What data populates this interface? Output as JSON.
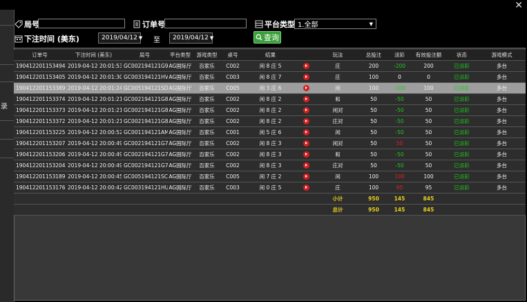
{
  "side_fragment": "录",
  "filters": {
    "round_label": "局号",
    "round_value": "",
    "order_label": "订单号",
    "order_value": "",
    "platform_label": "平台类型",
    "platform_value": "1.全部",
    "time_label": "下注时间 (美东)",
    "date_from": "2019/04/12",
    "to_label": "至",
    "date_to": "2019/04/12",
    "query_label": "查询"
  },
  "table": {
    "headers": [
      "订单号",
      "下注时间 (美东)",
      "局号",
      "平台类型",
      "游戏类型",
      "桌号",
      "结果",
      "",
      "玩法",
      "总投注",
      "派彩",
      "有效投注额",
      "状态",
      "游戏模式"
    ],
    "rows": [
      [
        "190412201153494",
        "2019-04-12 20:01:53",
        "GC002194121G9",
        "AG国际厅",
        "百家乐",
        "C002",
        "闲 8 庄 5",
        "",
        "庄",
        "200",
        "-200",
        "200",
        "已派彩",
        "多台"
      ],
      [
        "190412201153405",
        "2019-04-12 20:01:30",
        "GC003194121HV",
        "AG国际厅",
        "百家乐",
        "C003",
        "闲 8 庄 7",
        "",
        "庄",
        "100",
        "0",
        "0",
        "已派彩",
        "多台"
      ],
      [
        "190412201153389",
        "2019-04-12 20:01:24",
        "GC005194121SD",
        "AG国际厅",
        "百家乐",
        "C005",
        "闲 3 庄 6",
        "",
        "闲",
        "100",
        "-100",
        "100",
        "已派彩",
        "多台"
      ],
      [
        "190412201153374",
        "2019-04-12 20:01:21",
        "GC002194121G8",
        "AG国际厅",
        "百家乐",
        "C002",
        "闲 8 庄 2",
        "",
        "和",
        "50",
        "-50",
        "50",
        "已派彩",
        "多台"
      ],
      [
        "190412201153373",
        "2019-04-12 20:01:21",
        "GC002194121G8",
        "AG国际厅",
        "百家乐",
        "C002",
        "闲 8 庄 2",
        "",
        "闲对",
        "50",
        "-50",
        "50",
        "已派彩",
        "多台"
      ],
      [
        "190412201153372",
        "2019-04-12 20:01:21",
        "GC002194121G8",
        "AG国际厅",
        "百家乐",
        "C002",
        "闲 8 庄 2",
        "",
        "庄对",
        "50",
        "-50",
        "50",
        "已派彩",
        "多台"
      ],
      [
        "190412201153225",
        "2019-04-12 20:00:52",
        "GC001194121AM",
        "AG国际厅",
        "百家乐",
        "C001",
        "闲 5 庄 6",
        "",
        "闲",
        "50",
        "-50",
        "50",
        "已派彩",
        "多台"
      ],
      [
        "190412201153207",
        "2019-04-12 20:00:49",
        "GC002194121G7",
        "AG国际厅",
        "百家乐",
        "C002",
        "闲 8 庄 3",
        "",
        "闲对",
        "50",
        "50",
        "50",
        "已派彩",
        "多台"
      ],
      [
        "190412201153206",
        "2019-04-12 20:00:49",
        "GC002194121G7",
        "AG国际厅",
        "百家乐",
        "C002",
        "闲 8 庄 3",
        "",
        "和",
        "50",
        "-50",
        "50",
        "已派彩",
        "多台"
      ],
      [
        "190412201153204",
        "2019-04-12 20:00:49",
        "GC002194121G7",
        "AG国际厅",
        "百家乐",
        "C002",
        "闲 8 庄 3",
        "",
        "庄对",
        "50",
        "-50",
        "50",
        "已派彩",
        "多台"
      ],
      [
        "190412201153189",
        "2019-04-12 20:00:45",
        "GC005194121SC",
        "AG国际厅",
        "百家乐",
        "C005",
        "闲 7 庄 2",
        "",
        "闲",
        "100",
        "100",
        "100",
        "已派彩",
        "多台"
      ],
      [
        "190412201153176",
        "2019-04-12 20:00:42",
        "GC003194121HU",
        "AG国际厅",
        "百家乐",
        "C003",
        "闲 0 庄 5",
        "",
        "庄",
        "100",
        "95",
        "95",
        "已派彩",
        "多台"
      ]
    ],
    "subtotal": {
      "label": "小计",
      "total_bet": "950",
      "payout": "145",
      "valid_bet": "845"
    },
    "total": {
      "label": "总计",
      "total_bet": "950",
      "payout": "145",
      "valid_bet": "845"
    }
  },
  "colors": {
    "payout_negative": "#1ec81e",
    "payout_positive": "#e02020",
    "payout_zero": "#ffffff",
    "status": "#1ec81e",
    "totals": "#e6cf1e"
  },
  "selected_row": 2
}
